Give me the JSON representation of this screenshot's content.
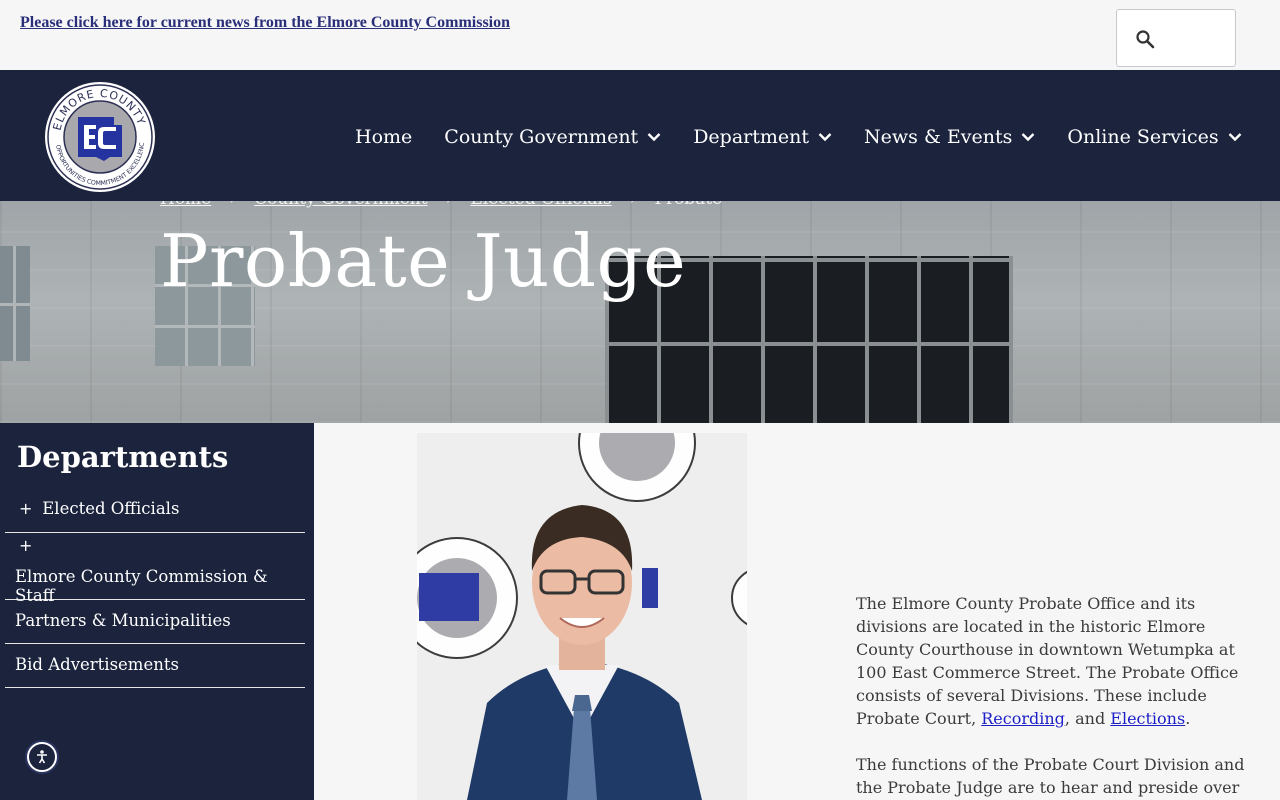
{
  "alert": {
    "link_text": "Please click here for current news from the Elmore County Commission"
  },
  "search": {
    "icon": "search-icon"
  },
  "logo": {
    "top_text": "ELMORE COUNTY",
    "bottom_text": "OPPORTUNITIES COMMITMENT EXCELLENCE",
    "monogram": "EC"
  },
  "nav": {
    "items": [
      {
        "label": "Home",
        "dropdown": false
      },
      {
        "label": "County Government",
        "dropdown": true
      },
      {
        "label": "Department",
        "dropdown": true
      },
      {
        "label": "News & Events",
        "dropdown": true
      },
      {
        "label": "Online Services",
        "dropdown": true
      }
    ]
  },
  "breadcrumb": {
    "items": [
      "Home",
      "County Government",
      "Elected Officials",
      "Probate"
    ],
    "separator": "›"
  },
  "page": {
    "title": "Probate Judge"
  },
  "sidebar": {
    "heading": "Departments",
    "items": [
      {
        "label": "Elected Officials",
        "expandable": true
      },
      {
        "label": "",
        "expandable": true
      },
      {
        "label": "Elmore County Commission & Staff",
        "expandable": false
      },
      {
        "label": "Partners & Municipalities",
        "expandable": false
      },
      {
        "label": "Bid Advertisements",
        "expandable": false
      }
    ]
  },
  "content": {
    "p1_before": "The Elmore County Probate Office and its divisions are located in the historic Elmore County Courthouse in downtown Wetumpka at 100 East Commerce Street. The Probate Office consists of several Divisions. These include Probate Court, ",
    "p1_link1": "Recording",
    "p1_mid": ", and ",
    "p1_link2": "Elections",
    "p1_end": ".",
    "p2": "The functions of the Probate Court Division and the Probate Judge are to hear and preside over"
  },
  "colors": {
    "navy": "#1b233d",
    "link": "#1c1fc8",
    "alert_link": "#2a2f7a",
    "background": "#f6f6f6"
  }
}
